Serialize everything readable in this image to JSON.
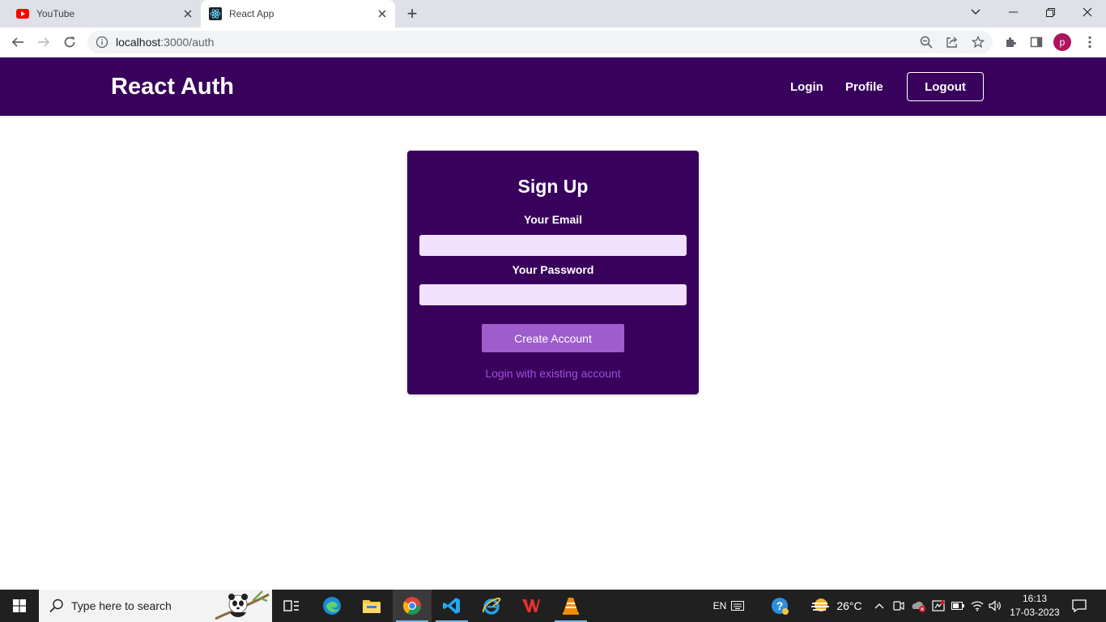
{
  "browser": {
    "tabs": [
      {
        "title": "YouTube",
        "icon": "youtube-icon"
      },
      {
        "title": "React App",
        "icon": "react-icon",
        "active": true
      }
    ],
    "new_tab_label": "+",
    "address": {
      "host": "localhost",
      "rest": ":3000/auth"
    },
    "profile_initial": "p"
  },
  "app": {
    "brand": "React Auth",
    "nav": {
      "login": "Login",
      "profile": "Profile",
      "logout": "Logout"
    },
    "auth_form": {
      "title": "Sign Up",
      "email_label": "Your Email",
      "email_value": "",
      "password_label": "Your Password",
      "password_value": "",
      "submit_label": "Create Account",
      "toggle_label": "Login with existing account"
    },
    "colors": {
      "primary": "#38015c",
      "input_bg": "#f1e1fc",
      "button": "#9f5ccc",
      "link": "#a050dc"
    }
  },
  "taskbar": {
    "search_placeholder": "Type here to search",
    "language": "EN",
    "temperature": "26°C",
    "time": "16:13",
    "date": "17-03-2023",
    "apps": [
      "task-view-icon",
      "edge-icon",
      "file-explorer-icon",
      "chrome-icon",
      "vscode-icon",
      "internet-explorer-icon",
      "wps-office-icon",
      "vlc-icon"
    ]
  }
}
